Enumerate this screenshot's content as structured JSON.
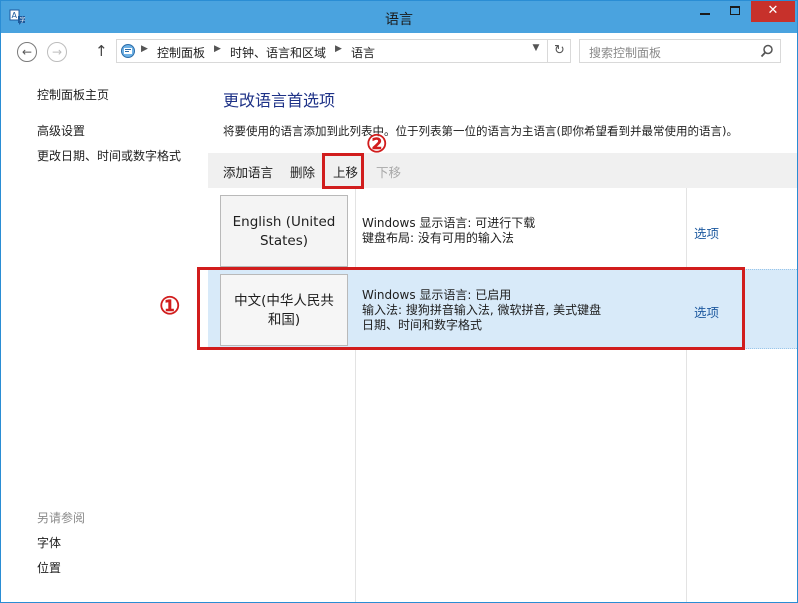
{
  "window": {
    "title": "语言"
  },
  "titlebar": {
    "minimize": "—",
    "maximize": "□",
    "close": "✕"
  },
  "nav": {
    "back": "←",
    "forward": "→",
    "up": "↑",
    "breadcrumb": [
      "控制面板",
      "时钟、语言和区域",
      "语言"
    ],
    "refresh": "↻",
    "search_placeholder": "搜索控制面板"
  },
  "sidebar": {
    "items": [
      {
        "label": "控制面板主页"
      },
      {
        "label": "高级设置"
      },
      {
        "label": "更改日期、时间或数字格式"
      }
    ],
    "see_also": {
      "label": "另请参阅",
      "items": [
        {
          "label": "字体"
        },
        {
          "label": "位置"
        }
      ]
    }
  },
  "main": {
    "heading": "更改语言首选项",
    "description": "将要使用的语言添加到此列表中。位于列表第一位的语言为主语言(即你希望看到并最常使用的语言)。",
    "toolbar": {
      "add": "添加语言",
      "remove": "删除",
      "move_up": "上移",
      "move_down": "下移"
    },
    "languages": [
      {
        "name_line1": "English (United",
        "name_line2": "States)",
        "info": [
          "Windows 显示语言: 可进行下载",
          "键盘布局: 没有可用的输入法"
        ],
        "options": "选项",
        "selected": false
      },
      {
        "name_line1": "中文(中华人民共",
        "name_line2": "和国)",
        "info": [
          "Windows 显示语言: 已启用",
          "输入法: 搜狗拼音输入法, 微软拼音, 美式键盘",
          "日期、时间和数字格式"
        ],
        "options": "选项",
        "selected": true
      }
    ]
  },
  "annotations": {
    "step1": "①",
    "step2": "②"
  },
  "colors": {
    "titlebar": "#4aa3df",
    "close": "#c7312b",
    "selection": "#d8eaf9",
    "annotation": "#d11d1d",
    "link": "#1e5aa0",
    "heading": "#1e3287"
  }
}
